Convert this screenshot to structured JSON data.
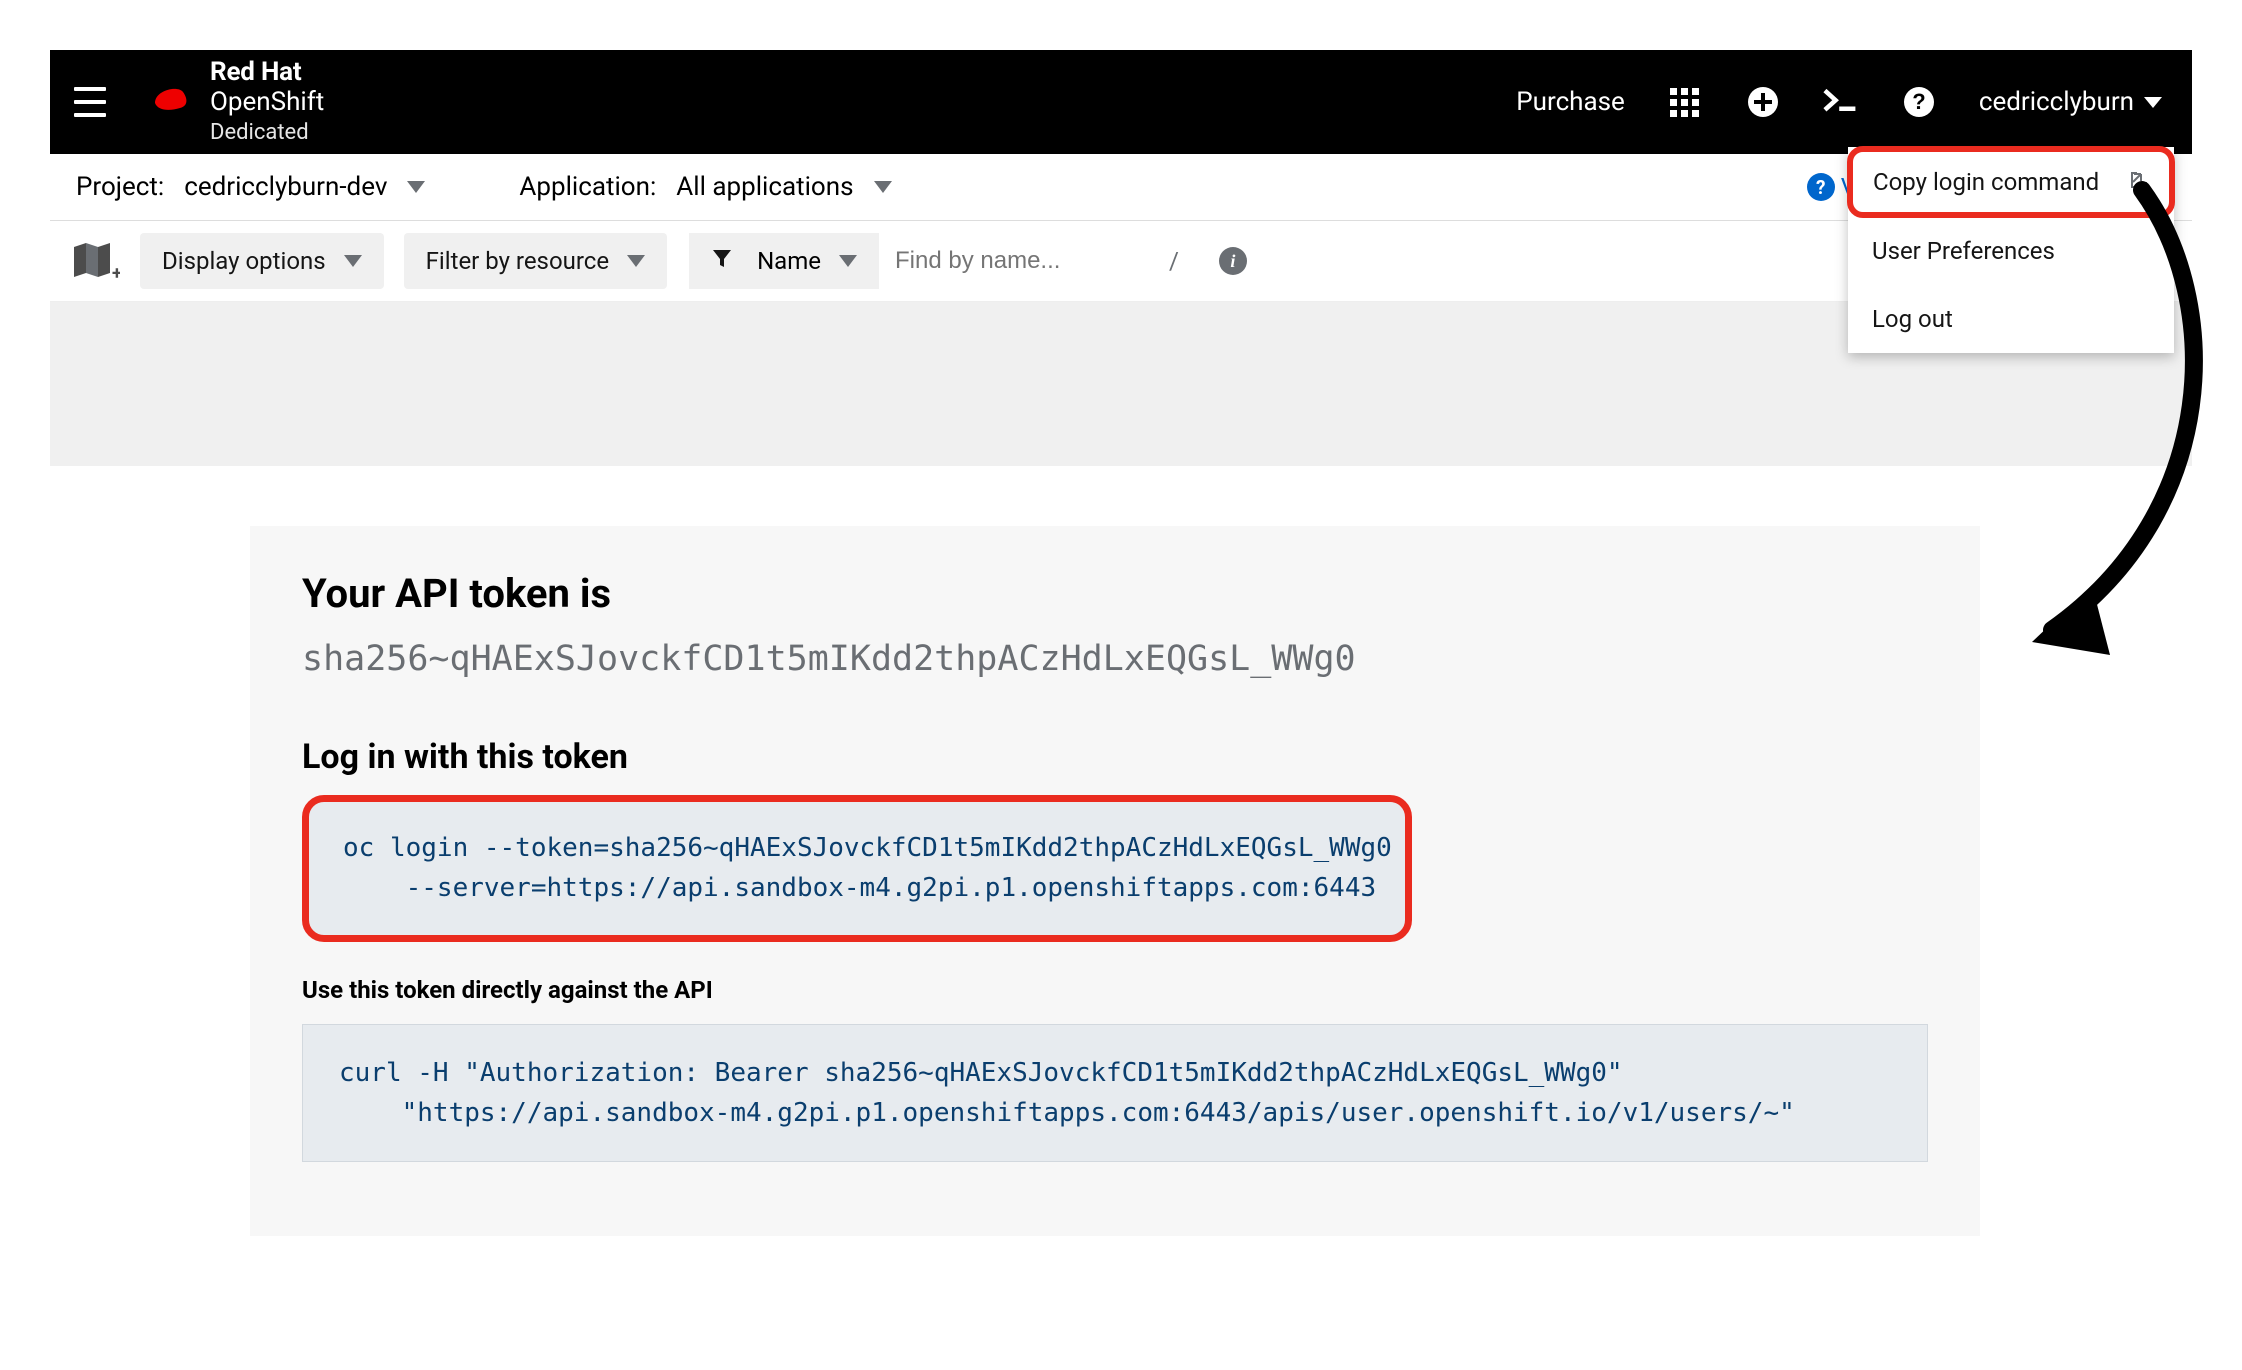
{
  "brand": {
    "line1": "Red Hat",
    "line2": "OpenShift",
    "line3": "Dedicated"
  },
  "masthead": {
    "purchase": "Purchase",
    "username": "cedricclyburn"
  },
  "user_menu": {
    "items": [
      {
        "label": "Copy login command",
        "external": true,
        "highlight": true
      },
      {
        "label": "User Preferences",
        "external": false,
        "highlight": false
      },
      {
        "label": "Log out",
        "external": false,
        "highlight": false
      }
    ]
  },
  "context_bar": {
    "project_label": "Project:",
    "project_value": "cedricclyburn-dev",
    "app_label": "Application:",
    "app_value": "All applications",
    "help_partial": "V"
  },
  "toolbar": {
    "display_options": "Display options",
    "filter_by_resource": "Filter by resource",
    "name": "Name",
    "search_placeholder": "Find by name...",
    "separator": "/"
  },
  "token_page": {
    "heading": "Your API token is",
    "token_value": "sha256~qHAExSJovckfCD1t5mIKdd2thpACzHdLxEQGsL_WWg0",
    "login_heading": "Log in with this token",
    "login_cmd": "oc login --token=sha256~qHAExSJovckfCD1t5mIKdd2thpACzHdLxEQGsL_WWg0\n    --server=https://api.sandbox-m4.g2pi.p1.openshiftapps.com:6443",
    "api_subheading": "Use this token directly against the API",
    "curl_cmd": "curl -H \"Authorization: Bearer sha256~qHAExSJovckfCD1t5mIKdd2thpACzHdLxEQGsL_WWg0\"\n    \"https://api.sandbox-m4.g2pi.p1.openshiftapps.com:6443/apis/user.openshift.io/v1/users/~\""
  }
}
